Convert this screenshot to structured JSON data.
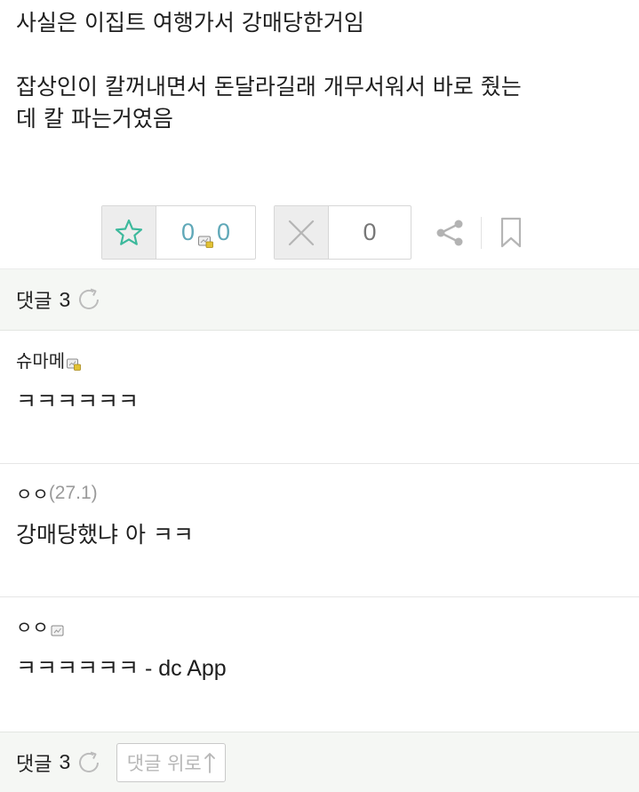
{
  "post": {
    "line1": "사실은 이집트 여행가서 강매당한거임",
    "line2": "잡상인이 칼꺼내면서 돈달라길래 개무서워서 바로 줬는",
    "line3": "데 칼 파는거였음"
  },
  "actions": {
    "recommend_count": "0",
    "fixed_recommend_count": "0",
    "nonrecommend_count": "0",
    "icons": {
      "recommend": "star-outline-icon",
      "fixed_recommend": "fixed-user-icon",
      "nonrecommend": "x-icon",
      "share": "share-icon",
      "bookmark": "bookmark-icon"
    },
    "colors": {
      "star": "#3cb99c",
      "count": "#5fa8b8"
    }
  },
  "comments_header": {
    "label": "댓글",
    "count": "3"
  },
  "comments": [
    {
      "author": "슈마메",
      "author_icon": "fixed-user-icon",
      "text": "ㅋㅋㅋㅋㅋㅋ"
    },
    {
      "author": "ㅇㅇ",
      "ip": "(27.1)",
      "text": "강매당했냐 아 ㅋㅋ"
    },
    {
      "author": "ㅇㅇ",
      "author_icon": "half-fixed-user-icon",
      "text": "ㅋㅋㅋㅋㅋㅋ",
      "suffix": " - dc App"
    }
  ],
  "comments_footer": {
    "label": "댓글",
    "count": "3",
    "to_top_label": "댓글 위로",
    "to_top_icon": "arrow-up-icon"
  }
}
